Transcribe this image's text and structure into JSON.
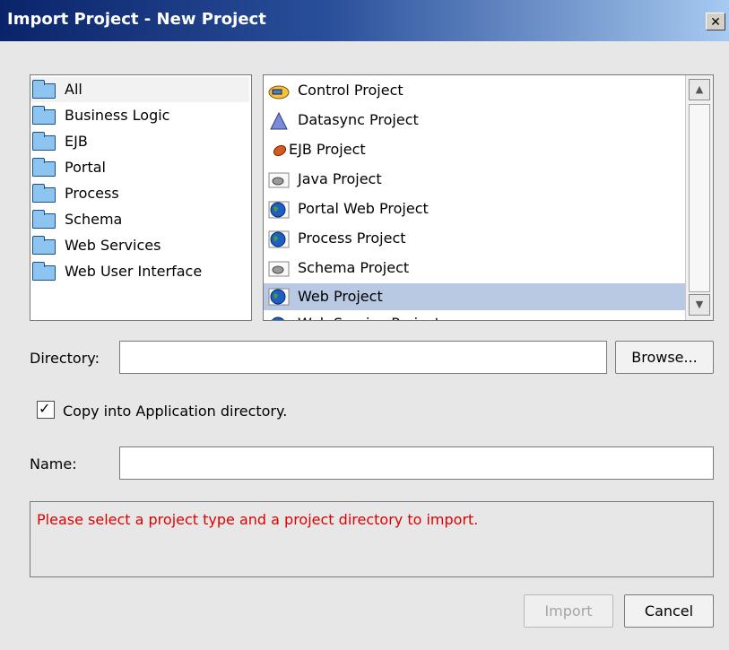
{
  "window": {
    "title": "Import Project - New Project",
    "close_label": "✕"
  },
  "categories": [
    {
      "label": "All"
    },
    {
      "label": "Business Logic"
    },
    {
      "label": "EJB"
    },
    {
      "label": "Portal"
    },
    {
      "label": "Process"
    },
    {
      "label": "Schema"
    },
    {
      "label": "Web Services"
    },
    {
      "label": "Web User Interface"
    }
  ],
  "project_types": [
    {
      "label": "Control Project"
    },
    {
      "label": "Datasync Project"
    },
    {
      "label": "EJB Project"
    },
    {
      "label": "Java Project"
    },
    {
      "label": "Portal Web Project"
    },
    {
      "label": "Process Project"
    },
    {
      "label": "Schema Project"
    },
    {
      "label": "Web Project"
    },
    {
      "label": "Web Service Project"
    }
  ],
  "directory": {
    "label": "Directory:",
    "value": "",
    "browse_label": "Browse..."
  },
  "copy_checkbox": {
    "label": "Copy into Application directory.",
    "checked": true
  },
  "name_field": {
    "label": "Name:",
    "value": ""
  },
  "message": "Please select a project type and a project directory to import.",
  "buttons": {
    "import_label": "Import",
    "cancel_label": "Cancel"
  }
}
